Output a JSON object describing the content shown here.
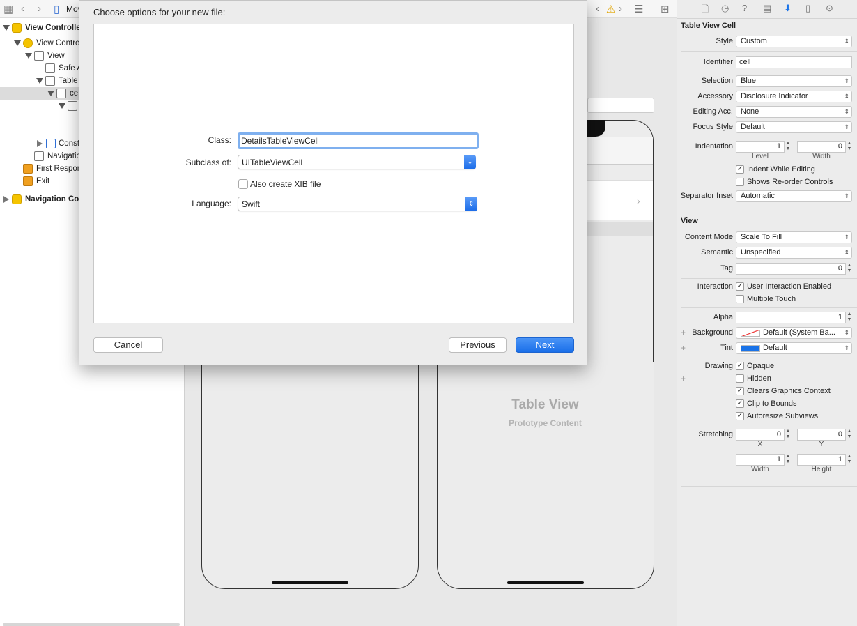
{
  "navigator": {
    "file_label": "Mov",
    "tree": [
      {
        "label": "View Controlle",
        "bold": true
      },
      {
        "label": "View Contro"
      },
      {
        "label": "View"
      },
      {
        "label": "Safe A"
      },
      {
        "label": "Table"
      },
      {
        "label": "ce"
      },
      {
        "label": ""
      },
      {
        "label": "Const"
      },
      {
        "label": "Navigatio"
      },
      {
        "label": "First Respon"
      },
      {
        "label": "Exit"
      },
      {
        "label": "Navigation Co",
        "bold": true
      }
    ]
  },
  "canvas": {
    "table_view_title": "Table View",
    "table_view_subtitle": "Prototype Content"
  },
  "sheet": {
    "title": "Choose options for your new file:",
    "class_label": "Class:",
    "class_value": "DetailsTableViewCell",
    "subclass_label": "Subclass of:",
    "subclass_value": "UITableViewCell",
    "xib_label": "Also create XIB file",
    "xib_checked": false,
    "language_label": "Language:",
    "language_value": "Swift",
    "cancel": "Cancel",
    "previous": "Previous",
    "next": "Next"
  },
  "inspector": {
    "cell_section": "Table View Cell",
    "style_label": "Style",
    "style_value": "Custom",
    "identifier_label": "Identifier",
    "identifier_value": "cell",
    "selection_label": "Selection",
    "selection_value": "Blue",
    "accessory_label": "Accessory",
    "accessory_value": "Disclosure Indicator",
    "editing_label": "Editing Acc.",
    "editing_value": "None",
    "focus_label": "Focus Style",
    "focus_value": "Default",
    "indentation_label": "Indentation",
    "indent_level": "1",
    "indent_width": "0",
    "level_sub": "Level",
    "width_sub": "Width",
    "indent_while_editing": "Indent While Editing",
    "shows_reorder": "Shows Re-order Controls",
    "separator_label": "Separator Inset",
    "separator_value": "Automatic",
    "view_section": "View",
    "content_mode_label": "Content Mode",
    "content_mode_value": "Scale To Fill",
    "semantic_label": "Semantic",
    "semantic_value": "Unspecified",
    "tag_label": "Tag",
    "tag_value": "0",
    "interaction_label": "Interaction",
    "user_interaction": "User Interaction Enabled",
    "multiple_touch": "Multiple Touch",
    "alpha_label": "Alpha",
    "alpha_value": "1",
    "background_label": "Background",
    "background_value": "Default (System Ba...",
    "tint_label": "Tint",
    "tint_value": "Default",
    "drawing_label": "Drawing",
    "opaque": "Opaque",
    "hidden": "Hidden",
    "clears_graphics": "Clears Graphics Context",
    "clip_bounds": "Clip to Bounds",
    "autoresize": "Autoresize Subviews",
    "stretching_label": "Stretching",
    "stretch_x": "0",
    "stretch_y": "0",
    "stretch_w": "1",
    "stretch_h": "1",
    "x_sub": "X",
    "y_sub": "Y",
    "w_sub": "Width",
    "h_sub": "Height",
    "check_mark": "✓",
    "colors": {
      "tint": "#1a73e8",
      "accent": "#2f7cf6"
    }
  }
}
